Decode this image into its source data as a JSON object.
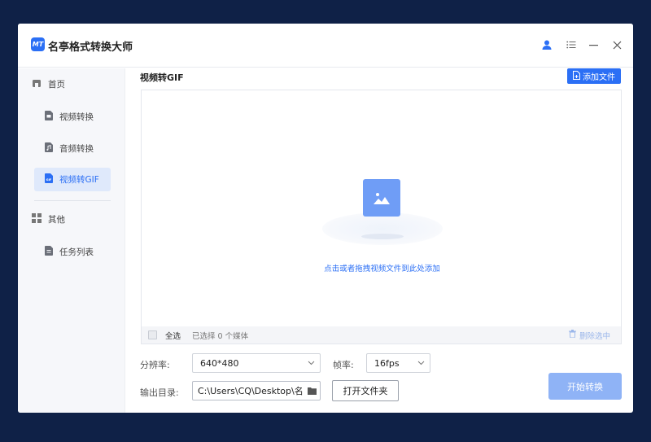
{
  "app": {
    "title": "名亭格式转换大师",
    "logo_text": "MT"
  },
  "sidebar": {
    "items": [
      {
        "label": "首页",
        "icon": "home-icon"
      },
      {
        "label": "视频转换",
        "icon": "video-file-icon"
      },
      {
        "label": "音频转换",
        "icon": "audio-file-icon"
      },
      {
        "label": "视频转GIF",
        "icon": "gif-file-icon",
        "active": true
      },
      {
        "label": "其他",
        "icon": "grid-icon"
      },
      {
        "label": "任务列表",
        "icon": "task-list-icon"
      }
    ]
  },
  "main": {
    "title": "视频转GIF",
    "add_file_label": "添加文件",
    "drop_hint": "点击或者拖拽视频文件到此处添加",
    "select_all_label": "全选",
    "selected_count_text": "已选择 0 个媒体",
    "delete_selected_label": "删除选中"
  },
  "form": {
    "resolution_label": "分辨率:",
    "resolution_value": "640*480",
    "framerate_label": "帧率:",
    "framerate_value": "16fps",
    "output_dir_label": "输出目录:",
    "output_dir_value": "C:\\Users\\CQ\\Desktop\\名",
    "open_folder_label": "打开文件夹",
    "start_label": "开始转换"
  },
  "colors": {
    "accent": "#2b6ff5",
    "start_button": "#8fb3f6",
    "background": "#0f2147"
  }
}
